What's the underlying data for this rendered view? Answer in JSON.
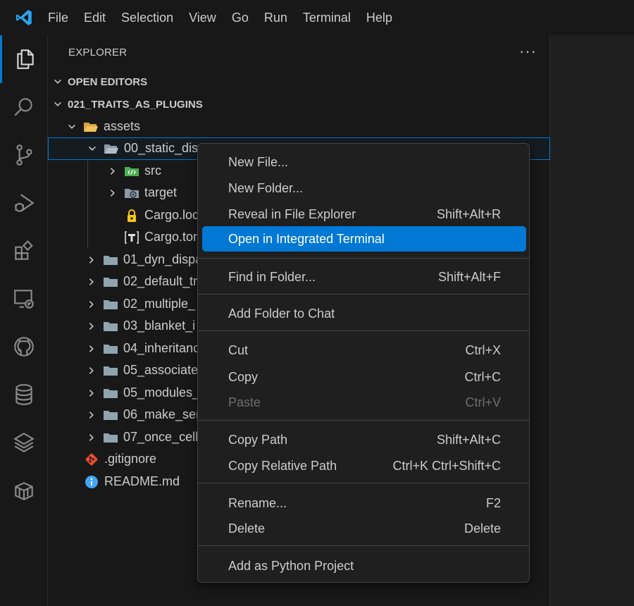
{
  "menubar": {
    "items": [
      "File",
      "Edit",
      "Selection",
      "View",
      "Go",
      "Run",
      "Terminal",
      "Help"
    ]
  },
  "activity_bar": {
    "icons": [
      "explorer-icon",
      "search-icon",
      "source-control-icon",
      "run-debug-icon",
      "extensions-icon",
      "remote-explorer-icon",
      "github-icon",
      "database-icon",
      "layers-icon",
      "package-icon"
    ],
    "accent_color": "#0078d4"
  },
  "explorer": {
    "header": "EXPLORER",
    "more": "···",
    "open_editors": "OPEN EDITORS",
    "workspace": "021_TRAITS_AS_PLUGINS",
    "tree": [
      {
        "label": "assets",
        "icon": "folder-open-icon"
      },
      {
        "label": "00_static_dis",
        "icon": "folder-open-icon"
      },
      {
        "label": "src",
        "icon": "folder-src-icon"
      },
      {
        "label": "target",
        "icon": "folder-target-icon"
      },
      {
        "label": "Cargo.loc",
        "icon": "lock-icon"
      },
      {
        "label": "Cargo.tor",
        "icon": "toml-icon"
      },
      {
        "label": "01_dyn_dispa",
        "icon": "folder-icon"
      },
      {
        "label": "02_default_tr",
        "icon": "folder-icon"
      },
      {
        "label": "02_multiple_",
        "icon": "folder-icon"
      },
      {
        "label": "03_blanket_i",
        "icon": "folder-icon"
      },
      {
        "label": "04_inheritanc",
        "icon": "folder-icon"
      },
      {
        "label": "05_associate",
        "icon": "folder-icon"
      },
      {
        "label": "05_modules_",
        "icon": "folder-icon"
      },
      {
        "label": "06_make_ser",
        "icon": "folder-icon"
      },
      {
        "label": "07_once_cell",
        "icon": "folder-icon"
      },
      {
        "label": ".gitignore",
        "icon": "git-icon"
      },
      {
        "label": "README.md",
        "icon": "info-icon"
      }
    ]
  },
  "context_menu": {
    "items": [
      {
        "label": "New File...",
        "key": ""
      },
      {
        "label": "New Folder...",
        "key": ""
      },
      {
        "label": "Reveal in File Explorer",
        "key": "Shift+Alt+R"
      },
      {
        "label": "Open in Integrated Terminal",
        "key": "",
        "highlighted": true
      },
      {
        "label": "Find in Folder...",
        "key": "Shift+Alt+F"
      },
      {
        "label": "Add Folder to Chat",
        "key": ""
      },
      {
        "label": "Cut",
        "key": "Ctrl+X"
      },
      {
        "label": "Copy",
        "key": "Ctrl+C"
      },
      {
        "label": "Paste",
        "key": "Ctrl+V",
        "disabled": true
      },
      {
        "label": "Copy Path",
        "key": "Shift+Alt+C"
      },
      {
        "label": "Copy Relative Path",
        "key": "Ctrl+K Ctrl+Shift+C"
      },
      {
        "label": "Rename...",
        "key": "F2"
      },
      {
        "label": "Delete",
        "key": "Delete"
      },
      {
        "label": "Add as Python Project",
        "key": ""
      }
    ],
    "highlight_color": "#0078d4"
  }
}
